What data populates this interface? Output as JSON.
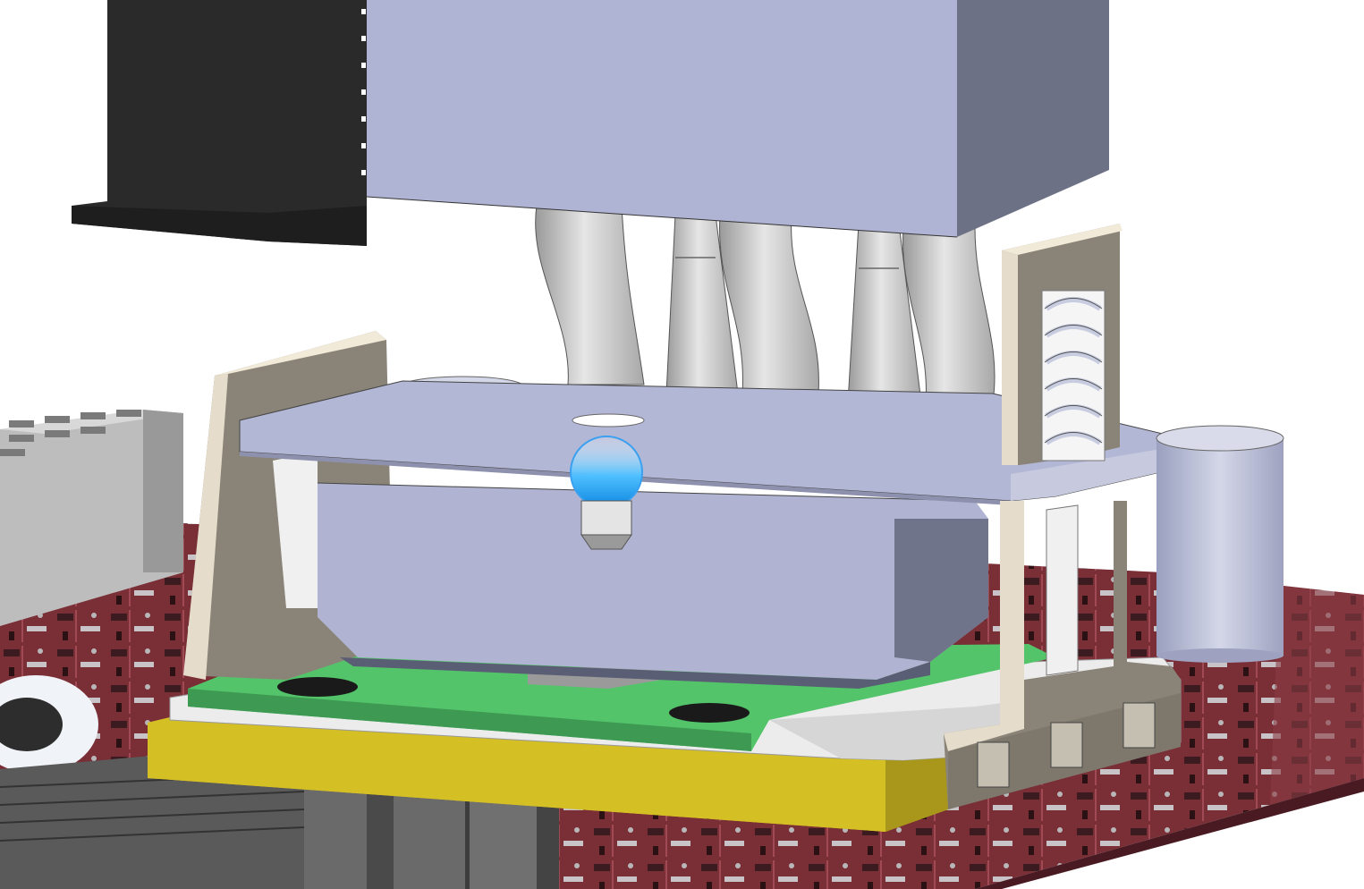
{
  "scene": {
    "kind": "3D CAD assembly render",
    "background_color": "#ffffff",
    "colors": {
      "pcb_board": "#7a2e36",
      "pcb_dark": "#4a1a22",
      "heatsink_fins": "#b0b4d4",
      "heatsink_side": "#6d7186",
      "dark_heatsink": "#2a2a2a",
      "heat_pipe": "#d9d9d9",
      "mount_plate": "#b3b7d6",
      "cooling_block": "#b0b4d2",
      "bracket": "#e6dccb",
      "bracket_shadow": "#8a8478",
      "spring": "#c8cce0",
      "green_pcb": "#53c46a",
      "socket_yellow": "#c8b41c",
      "socket_frame": "#ececec",
      "connector_dark": "#5a5a5a",
      "highlight_blue": "#2fa8f0",
      "standoff": "#c4c8da"
    }
  }
}
